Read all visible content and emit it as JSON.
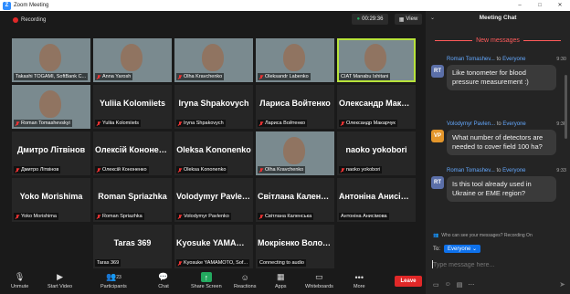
{
  "window": {
    "title": "Zoom Meeting",
    "controls": [
      "–",
      "□",
      "✕"
    ]
  },
  "meeting": {
    "recording_label": "Recording",
    "timer": "00:29:36",
    "view_label": "View"
  },
  "tiles": [
    {
      "big": "",
      "label": "Takashi TOGAMI, SoftBank C...",
      "video": "bg1",
      "muted": false
    },
    {
      "big": "",
      "label": "Anna Yarosh",
      "video": "bg2",
      "muted": true
    },
    {
      "big": "",
      "label": "Olha Kravchenko",
      "video": "bg3",
      "muted": true
    },
    {
      "big": "",
      "label": "Oleksandr Labenko",
      "video": "bg4",
      "muted": true
    },
    {
      "big": "",
      "label": "CIAT Manabu Ishitani",
      "video": "bg5",
      "muted": false,
      "active": true
    },
    {
      "big": "",
      "label": "Roman Tomashevskyi",
      "video": "bg6",
      "muted": true
    },
    {
      "big": "Yuliia Kolomiiets",
      "label": "Yuliia Kolomiiets",
      "muted": true
    },
    {
      "big": "Iryna Shpakovych",
      "label": "Iryna Shpakovych",
      "muted": true
    },
    {
      "big": "Лариса Войтенко",
      "label": "Лариса Войтенко",
      "muted": true
    },
    {
      "big": "Олександр Макарчук",
      "label": "Олександр Макарчук",
      "muted": true
    },
    {
      "big": "Дмитро Літвінов",
      "label": "Дмитро Літвінов",
      "muted": true
    },
    {
      "big": "Олексій Кононенко",
      "label": "Олексій Кононенко",
      "muted": true
    },
    {
      "big": "Oleksa Kononenko",
      "label": "Oleksa Kononenko",
      "muted": true
    },
    {
      "big": "",
      "label": "Olha Kravchenko",
      "video": "bg7",
      "muted": true
    },
    {
      "big": "naoko yokobori",
      "label": "naoko yokobori",
      "muted": true
    },
    {
      "big": "Yoko Morishima",
      "label": "Yoko Morishima",
      "muted": true
    },
    {
      "big": "Roman Spriazhka",
      "label": "Roman Spriazhka",
      "muted": true
    },
    {
      "big": "Volodymyr Pavlenko",
      "label": "Volodymyr Pavlenko",
      "muted": true
    },
    {
      "big": "Світлана Каленська",
      "label": "Світлана Каленська",
      "muted": true
    },
    {
      "big": "Антоніна Анисімова",
      "label": "Антоніна Анисімова",
      "muted": false
    },
    {
      "big": "",
      "label": "",
      "empty": true
    },
    {
      "big": "Taras 369",
      "label": "Taras 369",
      "muted": false
    },
    {
      "big": "Kyosuke YAMAMOTO",
      "label": "Kyosuke YAMAMOTO, Sof...",
      "muted": true
    },
    {
      "big": "Мокрієнко Володимир",
      "label": "Connecting to audio",
      "muted": false
    }
  ],
  "toolbar": {
    "unmute": "Unmute",
    "start_video": "Start Video",
    "participants": "Participants",
    "participants_count": "23",
    "chat": "Chat",
    "share_screen": "Share Screen",
    "reactions": "Reactions",
    "apps": "Apps",
    "whiteboards": "Whiteboards",
    "more": "More",
    "leave": "Leave"
  },
  "chat": {
    "title": "Meeting Chat",
    "new_messages": "New messages",
    "messages": [
      {
        "initials": "RT",
        "color": "#5b6fa8",
        "from": "Roman Tomashev...",
        "to_word": "to",
        "to": "Everyone",
        "time": "9:30",
        "text": "Like tonometer for blood pressure measurement :)"
      },
      {
        "initials": "VP",
        "color": "#e4962b",
        "from": "Volodymyr Pavlen...",
        "to_word": "to",
        "to": "Everyone",
        "time": "9:30",
        "text": "What number of detectors are needed to cover field 100 ha?"
      },
      {
        "initials": "RT",
        "color": "#5b6fa8",
        "from": "Roman Tomashev...",
        "to_word": "to",
        "to": "Everyone",
        "time": "9:33",
        "text": "Is this tool already used in Ukraine or EME region?"
      }
    ],
    "privacy_note": "Who can see your messages? Recording On",
    "to_label": "To:",
    "to_value": "Everyone",
    "placeholder": "Type message here...",
    "colors": {
      "accent": "#0e71eb",
      "new_messages": "#ff5b5b",
      "leave": "#e02828",
      "share": "#23a95f"
    }
  }
}
